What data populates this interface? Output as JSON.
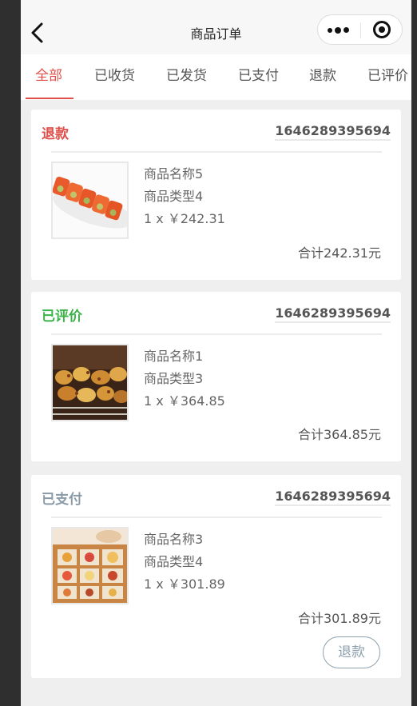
{
  "navbar": {
    "title": "商品订单"
  },
  "tabs": [
    {
      "label": "全部",
      "active": true
    },
    {
      "label": "已收货"
    },
    {
      "label": "已发货"
    },
    {
      "label": "已支付"
    },
    {
      "label": "退款"
    },
    {
      "label": "已评价"
    }
  ],
  "orders": [
    {
      "status": "退款",
      "status_color": "#e0504a",
      "order_no": "1646289395694",
      "product_name": "商品名称5",
      "product_type": "商品类型4",
      "qty_price": "1 x ￥242.31",
      "total": "合计242.31元",
      "image": "sushi-roll-image"
    },
    {
      "status": "已评价",
      "status_color": "#3bb34a",
      "order_no": "1646289395694",
      "product_name": "商品名称1",
      "product_type": "商品类型3",
      "qty_price": "1 x ￥364.85",
      "total": "合计364.85元",
      "image": "bbq-skewers-image"
    },
    {
      "status": "已支付",
      "status_color": "#8a9aa6",
      "order_no": "1646289395694",
      "product_name": "商品名称3",
      "product_type": "商品类型4",
      "qty_price": "1 x ￥301.89",
      "total": "合计301.89元",
      "image": "food-box-image",
      "action_label": "退款"
    }
  ],
  "colors": {
    "accent": "#e0504a",
    "background": "#efefef"
  }
}
